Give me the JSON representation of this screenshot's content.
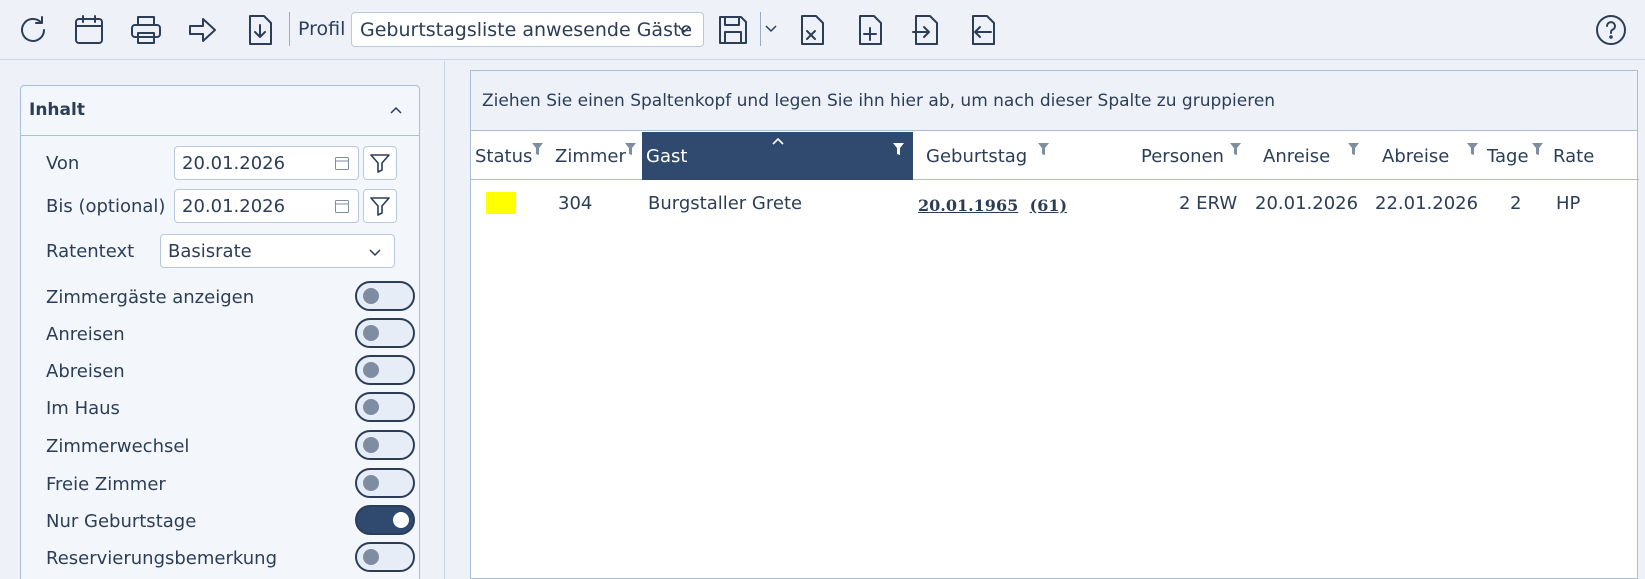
{
  "toolbar": {
    "icons": [
      "refresh-icon",
      "calendar-icon",
      "print-icon",
      "arrow-right-icon",
      "download-icon",
      "save-icon",
      "export-excel-icon",
      "add-file-icon",
      "import-file-icon",
      "export-file-icon",
      "help-icon"
    ],
    "profil_label": "Profil",
    "profil_value": "Geburtstagsliste anwesende Gäste"
  },
  "panel": {
    "title": "Inhalt",
    "von_label": "Von",
    "von_value": "20.01.2026",
    "bis_label": "Bis (optional)",
    "bis_value": "20.01.2026",
    "ratentext_label": "Ratentext",
    "ratentext_value": "Basisrate",
    "toggles": [
      {
        "label": "Zimmergäste anzeigen",
        "on": false
      },
      {
        "label": "Anreisen",
        "on": false
      },
      {
        "label": "Abreisen",
        "on": false
      },
      {
        "label": "Im Haus",
        "on": false
      },
      {
        "label": "Zimmerwechsel",
        "on": false
      },
      {
        "label": "Freie Zimmer",
        "on": false
      },
      {
        "label": "Nur Geburtstage",
        "on": true
      },
      {
        "label": "Reservierungsbemerkung",
        "on": false
      }
    ]
  },
  "grid": {
    "group_hint": "Ziehen Sie einen Spaltenkopf und legen Sie ihn hier ab, um nach dieser Spalte zu gruppieren",
    "columns": [
      "Status",
      "Zimmer",
      "Gast",
      "Geburtstag",
      "Personen",
      "Anreise",
      "Abreise",
      "Tage",
      "Rate"
    ],
    "sorted_column": "Gast",
    "rows": [
      {
        "status_color": "#ffff00",
        "zimmer": "304",
        "gast": "Burgstaller Grete",
        "geburtstag": "20.01.1965",
        "alter": "(61)",
        "personen": "2 ERW",
        "anreise": "20.01.2026",
        "abreise": "22.01.2026",
        "tage": "2",
        "rate": "HP"
      }
    ]
  }
}
